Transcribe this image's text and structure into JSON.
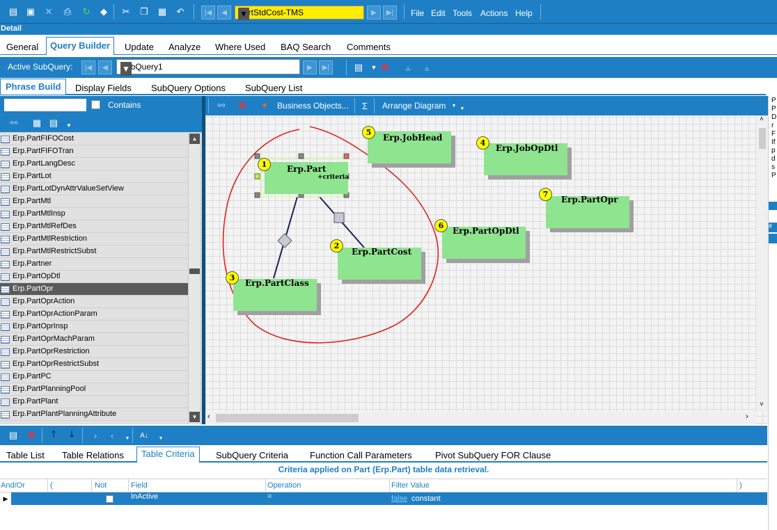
{
  "toolbar": {
    "query_name": "PartStdCost-TMS",
    "menu": [
      "File",
      "Edit",
      "Tools",
      "Actions",
      "Help"
    ]
  },
  "detail_label": "Detail",
  "main_tabs": [
    "General",
    "Query Builder",
    "Update",
    "Analyze",
    "Where Used",
    "BAQ Search",
    "Comments"
  ],
  "subquery": {
    "label": "Active SubQuery:",
    "value": "SubQuery1"
  },
  "phrase_tabs": [
    "Phrase Build",
    "Display Fields",
    "SubQuery Options",
    "SubQuery List"
  ],
  "table_list": {
    "search_value": "",
    "contains_label": "Contains",
    "items": [
      "Erp.PartFIFOCost",
      "Erp.PartFIFOTran",
      "Erp.PartLangDesc",
      "Erp.PartLot",
      "Erp.PartLotDynAttrValueSetView",
      "Erp.PartMtl",
      "Erp.PartMtlInsp",
      "Erp.PartMtlRefDes",
      "Erp.PartMtlRestriction",
      "Erp.PartMtlRestrictSubst",
      "Erp.Partner",
      "Erp.PartOpDtl",
      "Erp.PartOpr",
      "Erp.PartOprAction",
      "Erp.PartOprActionParam",
      "Erp.PartOprInsp",
      "Erp.PartOprMachParam",
      "Erp.PartOprRestriction",
      "Erp.PartOprRestrictSubst",
      "Erp.PartPC",
      "Erp.PartPlanningPool",
      "Erp.PartPlant",
      "Erp.PartPlantPlanningAttribute"
    ],
    "selected": "Erp.PartOpr"
  },
  "diagram_toolbar": {
    "business_objects": "Business Objects...",
    "sum_symbol": "Σ",
    "arrange": "Arrange Diagram"
  },
  "diagram_tables": [
    {
      "num": "1",
      "name": "Erp.Part",
      "sub": "+criteria"
    },
    {
      "num": "2",
      "name": "Erp.PartCost"
    },
    {
      "num": "3",
      "name": "Erp.PartClass"
    },
    {
      "num": "4",
      "name": "Erp.JobOpDtl"
    },
    {
      "num": "5",
      "name": "Erp.JobHead"
    },
    {
      "num": "6",
      "name": "Erp.PartOpDtl"
    },
    {
      "num": "7",
      "name": "Erp.PartOpr"
    }
  ],
  "bottom_tabs": [
    "Table List",
    "Table Relations",
    "Table Criteria",
    "SubQuery Criteria",
    "Function Call Parameters",
    "Pivot SubQuery FOR Clause"
  ],
  "criteria": {
    "title": "Criteria applied on Part (Erp.Part)  table data retrieval.",
    "headers": [
      "And/Or",
      "(",
      "Not",
      "Field",
      "Operation",
      "Filter Value",
      ")"
    ],
    "rows": [
      {
        "field": "InActive",
        "operation": "=",
        "value_link": "false",
        "value_type": "constant"
      }
    ]
  },
  "right_strip_letters": [
    "P",
    "P",
    "D",
    "r",
    "F",
    "If",
    "p",
    "d",
    "s",
    "P"
  ],
  "colors": {
    "accent": "#1f7fc4",
    "query_highlight": "#ffec00",
    "table_fill": "#8fe48f",
    "badge": "#ffff00",
    "annotation": "#e02020"
  }
}
